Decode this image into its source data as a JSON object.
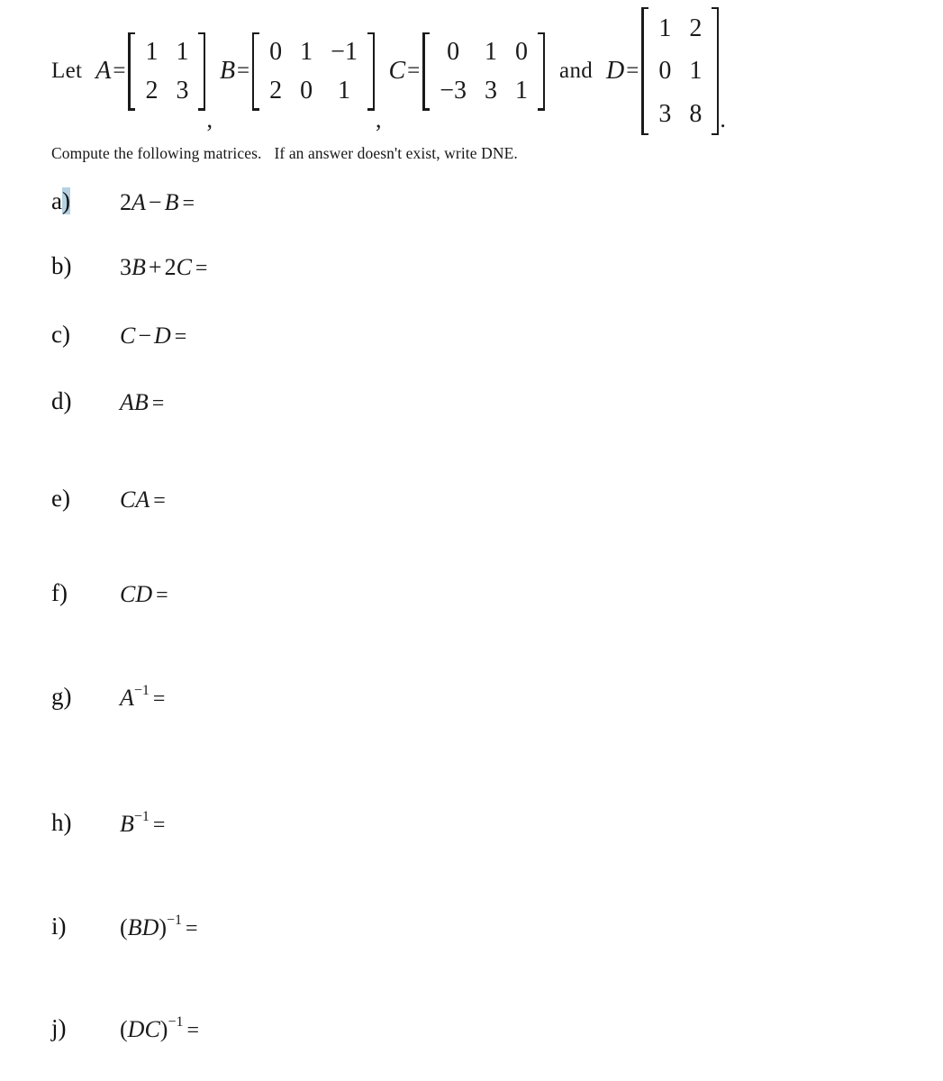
{
  "document": {
    "background_color": "#ffffff",
    "text_color": "#1a1a1a",
    "highlight_color": "#b5d2e3"
  },
  "definition": {
    "lead_word": "Let",
    "conjunction": "and",
    "terminal_period": ".",
    "separator": ",",
    "equals": "=",
    "matrices": [
      {
        "name": "A",
        "rows": 2,
        "cols": 2,
        "values": [
          [
            "1",
            "1"
          ],
          [
            "2",
            "3"
          ]
        ]
      },
      {
        "name": "B",
        "rows": 2,
        "cols": 3,
        "values": [
          [
            "0",
            "1",
            "−1"
          ],
          [
            "2",
            "0",
            "1"
          ]
        ]
      },
      {
        "name": "C",
        "rows": 2,
        "cols": 3,
        "values": [
          [
            "0",
            "1",
            "0"
          ],
          [
            "−3",
            "3",
            "1"
          ]
        ]
      },
      {
        "name": "D",
        "rows": 3,
        "cols": 2,
        "values": [
          [
            "1",
            "2"
          ],
          [
            "0",
            "1"
          ],
          [
            "3",
            "8"
          ]
        ]
      }
    ]
  },
  "instruction": {
    "sentence_part_1": "Compute the following matrices.",
    "sentence_part_2": "If an answer doesn't exist, write DNE."
  },
  "problems": [
    {
      "label": "a",
      "paren": ")",
      "highlighted": true,
      "expression_plain": "2A − B ="
    },
    {
      "label": "b",
      "paren": ")",
      "highlighted": false,
      "expression_plain": "3B + 2C ="
    },
    {
      "label": "c",
      "paren": ")",
      "highlighted": false,
      "expression_plain": "C − D ="
    },
    {
      "label": "d",
      "paren": ")",
      "highlighted": false,
      "expression_plain": "AB ="
    },
    {
      "label": "e",
      "paren": ")",
      "highlighted": false,
      "expression_plain": "CA ="
    },
    {
      "label": "f",
      "paren": ")",
      "highlighted": false,
      "expression_plain": "CD ="
    },
    {
      "label": "g",
      "paren": ")",
      "highlighted": false,
      "expression_plain": "A⁻¹ ="
    },
    {
      "label": "h",
      "paren": ")",
      "highlighted": false,
      "expression_plain": "B⁻¹ ="
    },
    {
      "label": "i",
      "paren": ")",
      "highlighted": false,
      "expression_plain": "(BD)⁻¹ ="
    },
    {
      "label": "j",
      "paren": ")",
      "highlighted": false,
      "expression_plain": "(DC)⁻¹ ="
    }
  ],
  "problem_tokens": {
    "a": {
      "coef": "2",
      "var1": "A",
      "op": "−",
      "var2": "B",
      "eq": "="
    },
    "b": {
      "coef": "3",
      "var1": "B",
      "op": "+",
      "coef2": "2",
      "var2": "C",
      "eq": "="
    },
    "c": {
      "var1": "C",
      "op": "−",
      "var2": "D",
      "eq": "="
    },
    "d": {
      "var1": "A",
      "var2": "B",
      "eq": "="
    },
    "e": {
      "var1": "C",
      "var2": "A",
      "eq": "="
    },
    "f": {
      "var1": "C",
      "var2": "D",
      "eq": "="
    },
    "g": {
      "var1": "A",
      "exp": "−1",
      "eq": "="
    },
    "h": {
      "var1": "B",
      "exp": "−1",
      "eq": "="
    },
    "i": {
      "open": "(",
      "var1": "B",
      "var2": "D",
      "close": ")",
      "exp": "−1",
      "eq": "="
    },
    "j": {
      "open": "(",
      "var1": "D",
      "var2": "C",
      "close": ")",
      "exp": "−1",
      "eq": "="
    }
  },
  "layout": {
    "problem_tops": [
      210,
      282,
      358,
      432,
      540,
      645,
      760,
      900,
      1015,
      1128
    ]
  }
}
